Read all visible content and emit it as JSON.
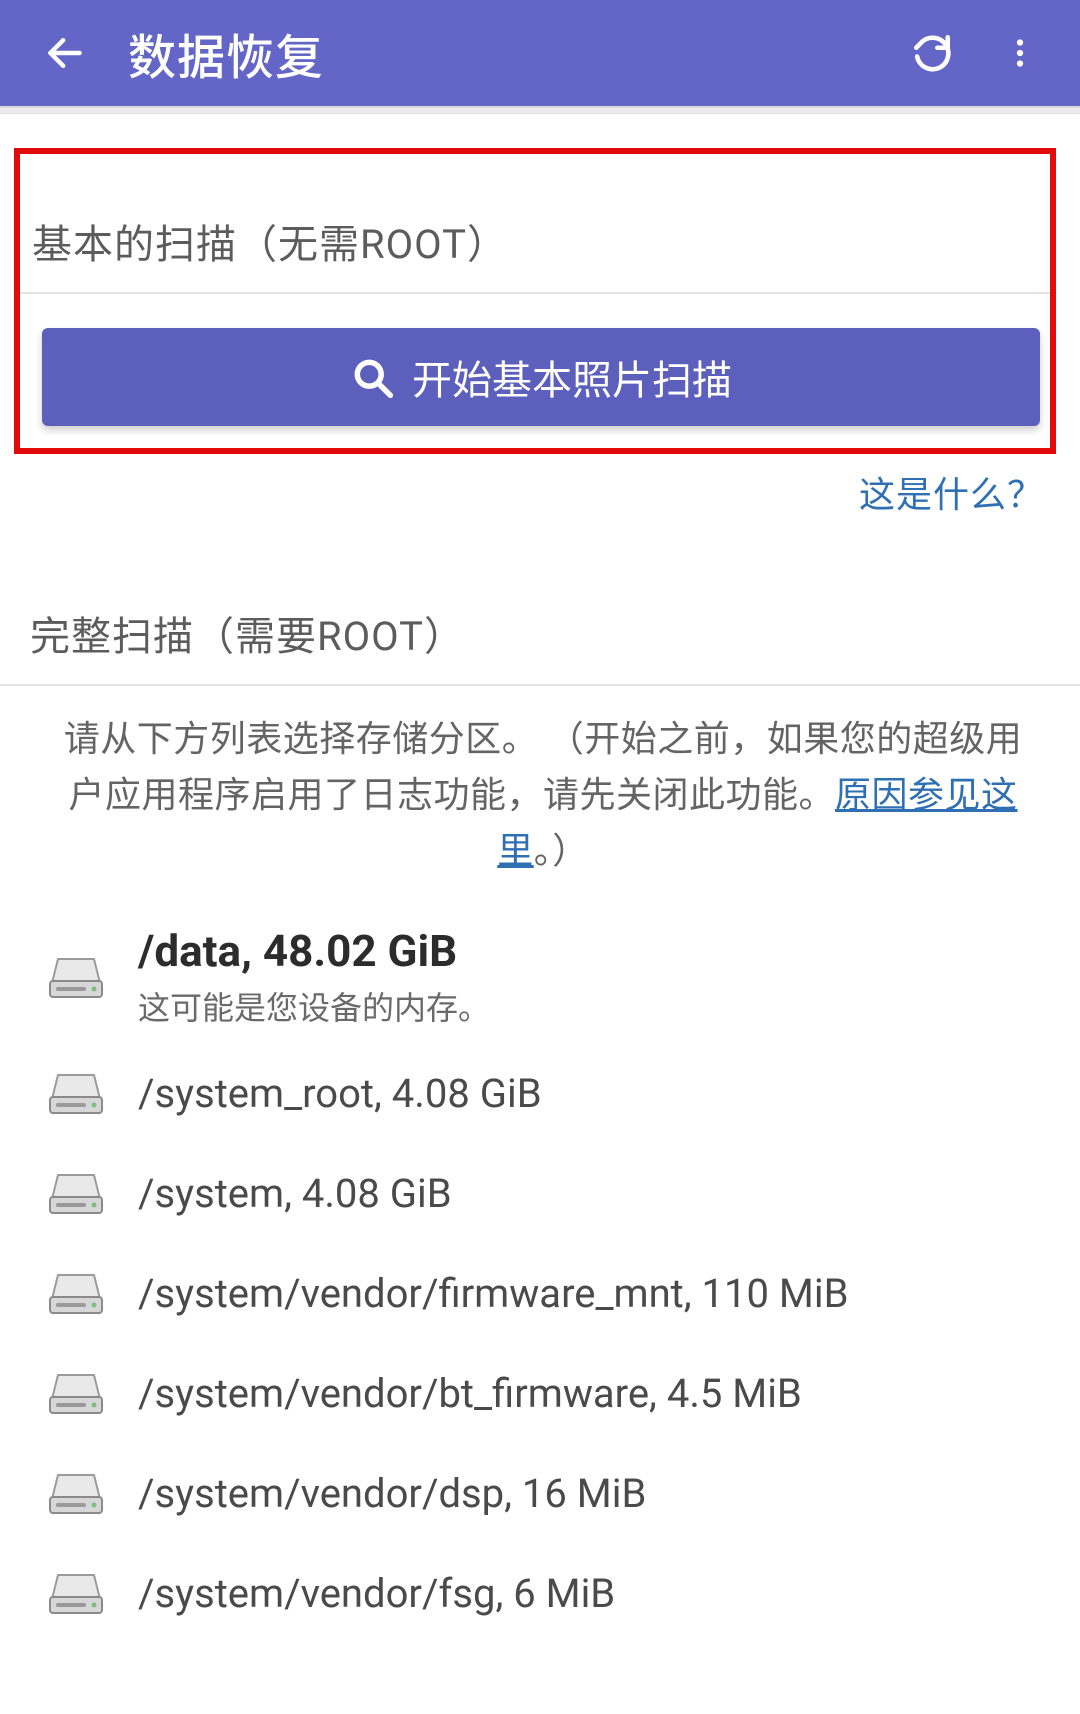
{
  "appbar": {
    "title": "数据恢复"
  },
  "basic": {
    "title": "基本的扫描（无需ROOT）",
    "button": "开始基本照片扫描",
    "whatis": "这是什么？"
  },
  "full": {
    "title": "完整扫描（需要ROOT）",
    "instruction_prefix": "请从下方列表选择存储分区。 （开始之前，如果您的超级用户应用程序启用了日志功能，请先关闭此功能。",
    "instruction_link": "原因参见这里",
    "instruction_suffix": "。）"
  },
  "primary_partition": {
    "line1": "/data, 48.02 GiB",
    "line2": "这可能是您设备的内存。"
  },
  "partitions": [
    {
      "label": "/system_root, 4.08 GiB"
    },
    {
      "label": "/system, 4.08 GiB"
    },
    {
      "label": "/system/vendor/firmware_mnt, 110 MiB"
    },
    {
      "label": "/system/vendor/bt_firmware, 4.5 MiB"
    },
    {
      "label": "/system/vendor/dsp, 16 MiB"
    },
    {
      "label": "/system/vendor/fsg, 6 MiB"
    }
  ]
}
